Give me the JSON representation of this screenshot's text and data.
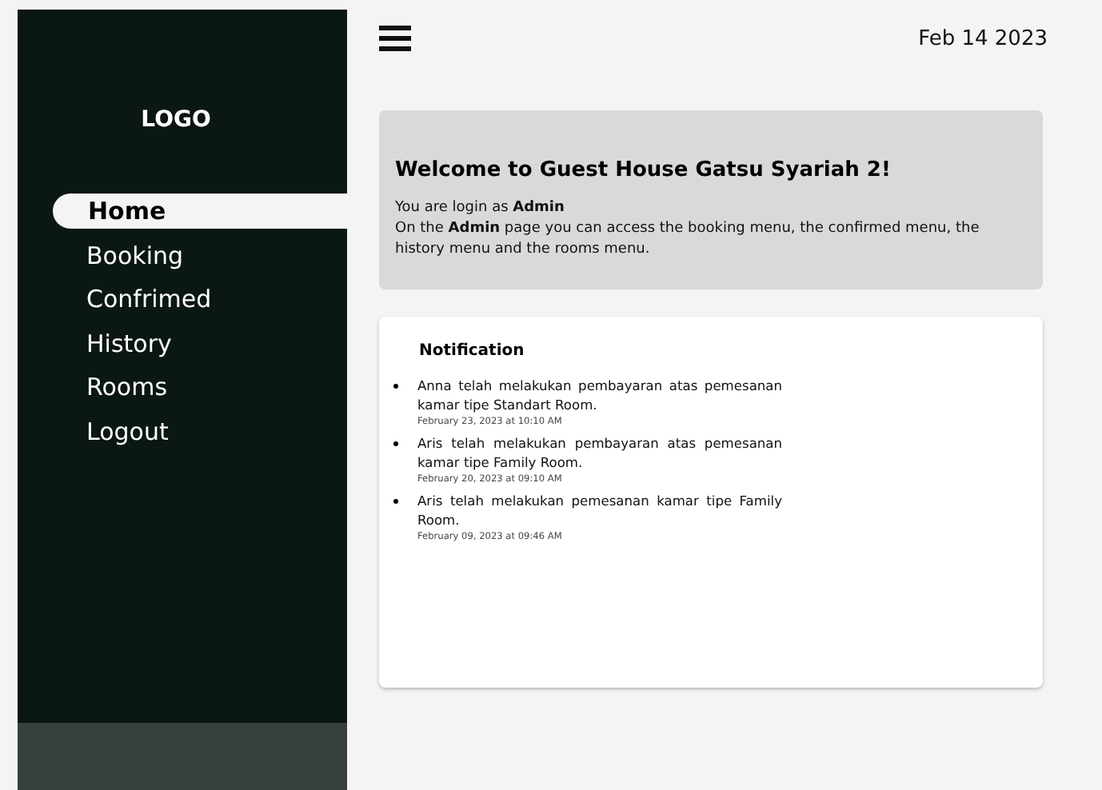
{
  "sidebar": {
    "logo": "LOGO",
    "items": [
      {
        "label": "Home",
        "selected": true
      },
      {
        "label": "Booking",
        "selected": false
      },
      {
        "label": "Confrimed",
        "selected": false
      },
      {
        "label": "History",
        "selected": false
      },
      {
        "label": "Rooms",
        "selected": false
      },
      {
        "label": "Logout",
        "selected": false
      }
    ]
  },
  "header": {
    "date": "Feb 14 2023"
  },
  "welcome": {
    "title": "Welcome to Guest House Gatsu Syariah 2!",
    "lines": [
      "You are login as **Admin**",
      "On the **Admin** page you can access the booking menu, the confirmed menu, the history menu and the rooms menu."
    ]
  },
  "notification": {
    "title": "Notification",
    "items": [
      {
        "text": "Anna telah melakukan pembayaran atas pemesanan kamar tipe Standart Room.",
        "time": "February 23, 2023 at 10:10 AM"
      },
      {
        "text": "Aris telah melakukan pembayaran atas pemesanan kamar tipe Family Room.",
        "time": "February 20, 2023 at 09:10 AM"
      },
      {
        "text": "Aris telah melakukan pemesanan kamar tipe Family Room.",
        "time": "February 09, 2023 at 09:46 AM"
      }
    ]
  }
}
